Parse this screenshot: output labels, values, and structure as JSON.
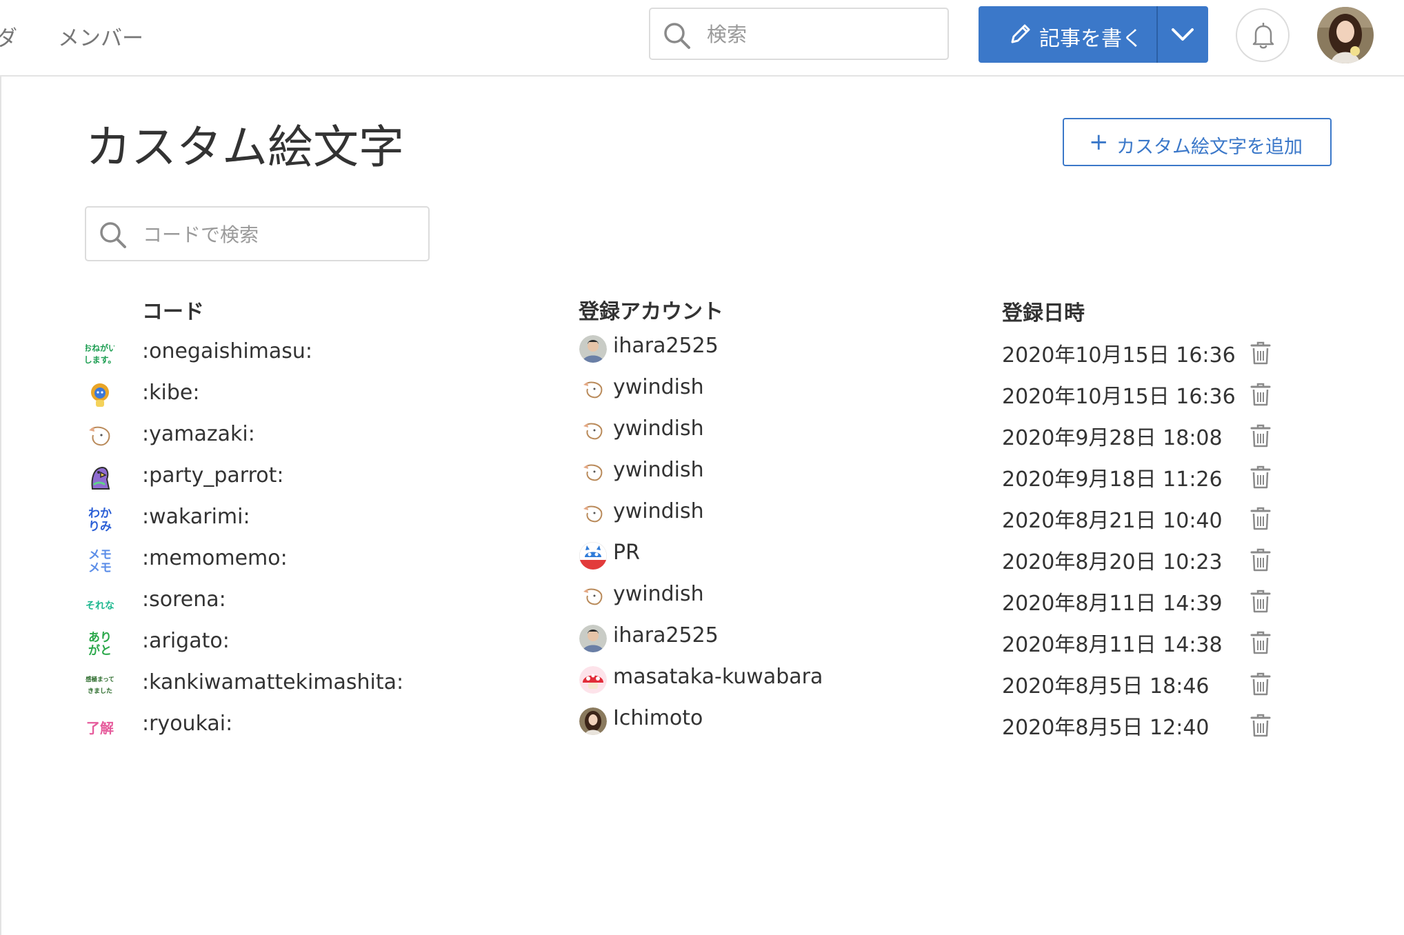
{
  "header": {
    "nav_partial": "ダ",
    "nav_members": "メンバー",
    "search_placeholder": "検索",
    "write_label": "記事を書く",
    "icons": {
      "search": "search-icon",
      "pencil": "pencil-icon",
      "dropdown": "chevron-down-icon",
      "bell": "bell-icon",
      "avatar": "user-avatar"
    }
  },
  "page": {
    "title": "カスタム絵文字",
    "add_button_plus": "+",
    "add_button_label": "カスタム絵文字を追加",
    "code_search_placeholder": "コードで検索"
  },
  "table": {
    "headers": {
      "code": "コード",
      "account": "登録アカウント",
      "date": "登録日時"
    },
    "rows": [
      {
        "emoji_text": [
          "おねがい",
          "します。"
        ],
        "code": ":onegaishimasu:",
        "account": "ihara2525",
        "date": "2020年10月15日 16:36"
      },
      {
        "emoji_text": [],
        "code": ":kibe:",
        "account": "ywindish",
        "date": "2020年10月15日 16:36"
      },
      {
        "emoji_text": [],
        "code": ":yamazaki:",
        "account": "ywindish",
        "date": "2020年9月28日 18:08"
      },
      {
        "emoji_text": [],
        "code": ":party_parrot:",
        "account": "ywindish",
        "date": "2020年9月18日 11:26"
      },
      {
        "emoji_text": [
          "わか",
          "りみ"
        ],
        "code": ":wakarimi:",
        "account": "ywindish",
        "date": "2020年8月21日 10:40"
      },
      {
        "emoji_text": [
          "メモ",
          "メモ"
        ],
        "code": ":memomemo:",
        "account": "PR",
        "date": "2020年8月20日 10:23"
      },
      {
        "emoji_text": [
          "それな"
        ],
        "code": ":sorena:",
        "account": "ywindish",
        "date": "2020年8月11日 14:39"
      },
      {
        "emoji_text": [
          "あり",
          "がと"
        ],
        "code": ":arigato:",
        "account": "ihara2525",
        "date": "2020年8月11日 14:38"
      },
      {
        "emoji_text": [
          "感極まって",
          "きました"
        ],
        "code": ":kankiwamattekimashita:",
        "account": "masataka-kuwabara",
        "date": "2020年8月5日 18:46"
      },
      {
        "emoji_text": [
          "了解"
        ],
        "code": ":ryoukai:",
        "account": "Ichimoto",
        "date": "2020年8月5日 12:40"
      }
    ]
  },
  "colors": {
    "primary": "#3b78c9",
    "border": "#dcdcdc",
    "text": "#333333",
    "muted": "#777777"
  }
}
